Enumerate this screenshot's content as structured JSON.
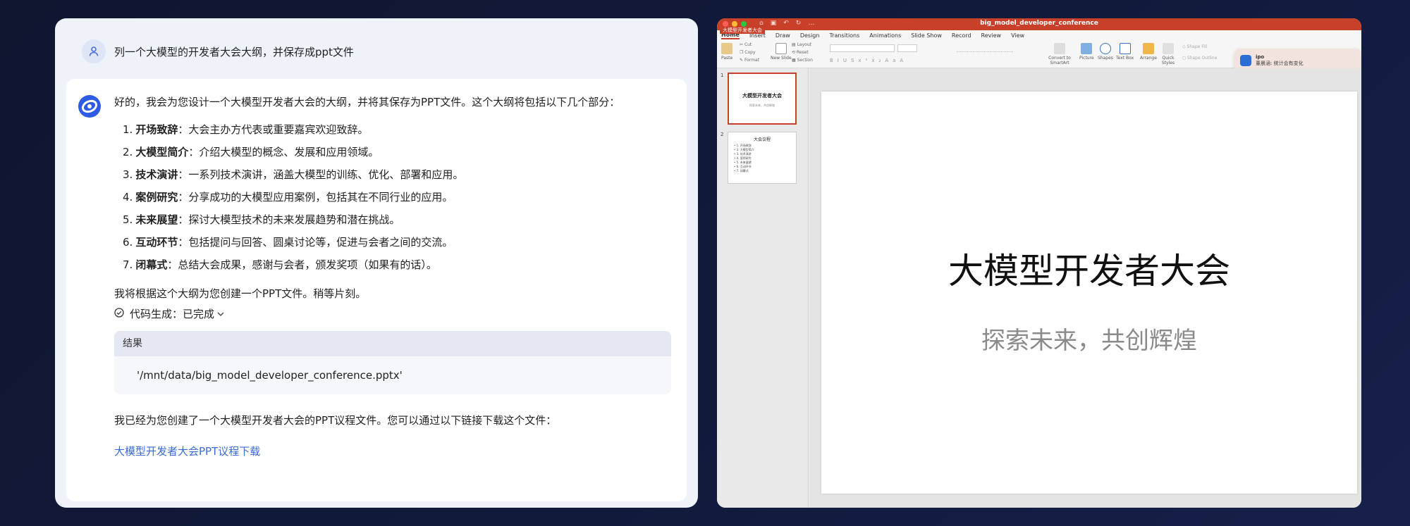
{
  "chat": {
    "user_prompt": "列一个大模型的开发者大会大纲，并保存成ppt文件",
    "intro": "好的，我会为您设计一个大模型开发者大会的大纲，并将其保存为PPT文件。这个大纲将包括以下几个部分：",
    "outline": [
      {
        "num": "1.",
        "title": "开场致辞",
        "desc": "：大会主办方代表或重要嘉宾欢迎致辞。"
      },
      {
        "num": "2.",
        "title": "大模型简介",
        "desc": "：介绍大模型的概念、发展和应用领域。"
      },
      {
        "num": "3.",
        "title": "技术演讲",
        "desc": "：一系列技术演讲，涵盖大模型的训练、优化、部署和应用。"
      },
      {
        "num": "4.",
        "title": "案例研究",
        "desc": "：分享成功的大模型应用案例，包括其在不同行业的应用。"
      },
      {
        "num": "5.",
        "title": "未来展望",
        "desc": "：探讨大模型技术的未来发展趋势和潜在挑战。"
      },
      {
        "num": "6.",
        "title": "互动环节",
        "desc": "：包括提问与回答、圆桌讨论等，促进与会者之间的交流。"
      },
      {
        "num": "7.",
        "title": "闭幕式",
        "desc": "：总结大会成果，感谢与会者，颁发奖项（如果有的话）。"
      }
    ],
    "after_list": "我将根据这个大纲为您创建一个PPT文件。稍等片刻。",
    "codegen_label": "代码生成：已完成",
    "result_label": "结果",
    "result_value": "'/mnt/data/big_model_developer_conference.pptx'",
    "final_text": "我已经为您创建了一个大模型开发者大会的PPT议程文件。您可以通过以下链接下载这个文件：",
    "download_link": "大模型开发者大会PPT议程下载"
  },
  "ppt": {
    "window_title": "big_model_developer_conference",
    "title_tag": "大模型开发者大会",
    "menu": [
      "Home",
      "Insert",
      "Draw",
      "Design",
      "Transitions",
      "Animations",
      "Slide Show",
      "Record",
      "Review",
      "View"
    ],
    "ribbon": {
      "paste": "Paste",
      "cut": "Cut",
      "copy": "Copy",
      "format": "Format",
      "new_slide": "New Slide",
      "layout": "Layout",
      "reset": "Reset",
      "section": "Section",
      "convert": "Convert to SmartArt",
      "picture": "Picture",
      "shapes": "Shapes",
      "text_box": "Text Box",
      "arrange": "Arrange",
      "quick_styles": "Quick Styles",
      "shape_fill": "Shape Fill",
      "shape_outline": "Shape Outline"
    },
    "notification": {
      "app": "ipo",
      "message": "董晨涵: 统计会有变化"
    },
    "thumbnails": [
      {
        "num": "1",
        "title": "大模型开发者大会",
        "subtitle": "探索未来，共创辉煌"
      },
      {
        "num": "2",
        "title": "大会议程",
        "items": [
          "开场致辞",
          "大模型简介",
          "技术演讲",
          "案例研究",
          "未来展望",
          "互动环节",
          "闭幕式"
        ]
      }
    ],
    "slide": {
      "title": "大模型开发者大会",
      "subtitle": "探索未来，共创辉煌"
    },
    "colors": {
      "accent": "#c8402a",
      "link": "#3a6bd8"
    }
  }
}
